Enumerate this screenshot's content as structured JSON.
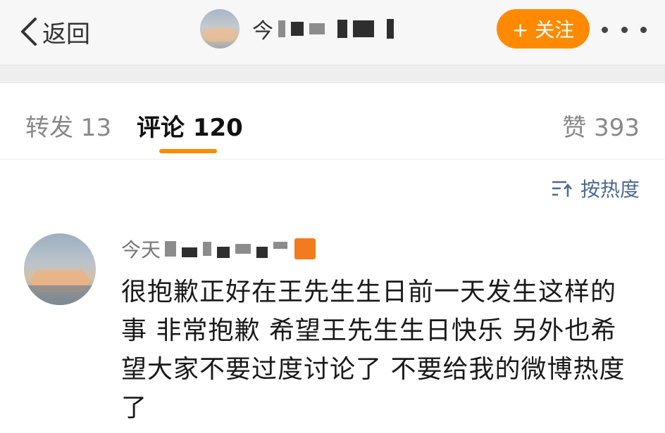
{
  "header": {
    "back_label": "返回",
    "user_name": "今",
    "follow_label": "+ 关注"
  },
  "tabs": [
    {
      "label": "转发 13"
    },
    {
      "label": "评论 120"
    },
    {
      "label": "赞 393"
    }
  ],
  "sort": {
    "label": "按热度"
  },
  "comment": {
    "author": "今天",
    "text": "很抱歉正好在王先生生日前一天发生这样的事 非常抱歉 希望王先生生日快乐 另外也希望大家不要过度讨论了 不要给我的微博热度了"
  },
  "colors": {
    "accent": "#ff8a00",
    "sort_text": "#4a6a8f"
  },
  "icons": [
    "chevron-left-icon",
    "more-dots-icon",
    "sort-icon"
  ]
}
